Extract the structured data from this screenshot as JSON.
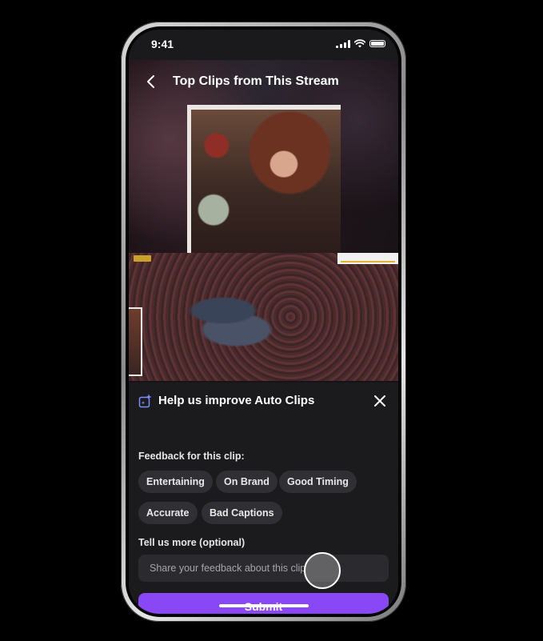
{
  "status_bar": {
    "time": "9:41"
  },
  "header": {
    "title": "Top Clips from This Stream"
  },
  "feedback_sheet": {
    "title": "Help us improve Auto Clips",
    "feedback_label": "Feedback for this clip:",
    "chips": [
      "Entertaining",
      "On Brand",
      "Good Timing",
      "Accurate",
      "Bad Captions"
    ],
    "more_label": "Tell us more (optional)",
    "input_placeholder": "Share your feedback about this clip",
    "submit_label": "Submit"
  },
  "colors": {
    "accent": "#8a47f5",
    "sheet_bg": "#1b1b1e",
    "chip_bg": "#303034"
  }
}
